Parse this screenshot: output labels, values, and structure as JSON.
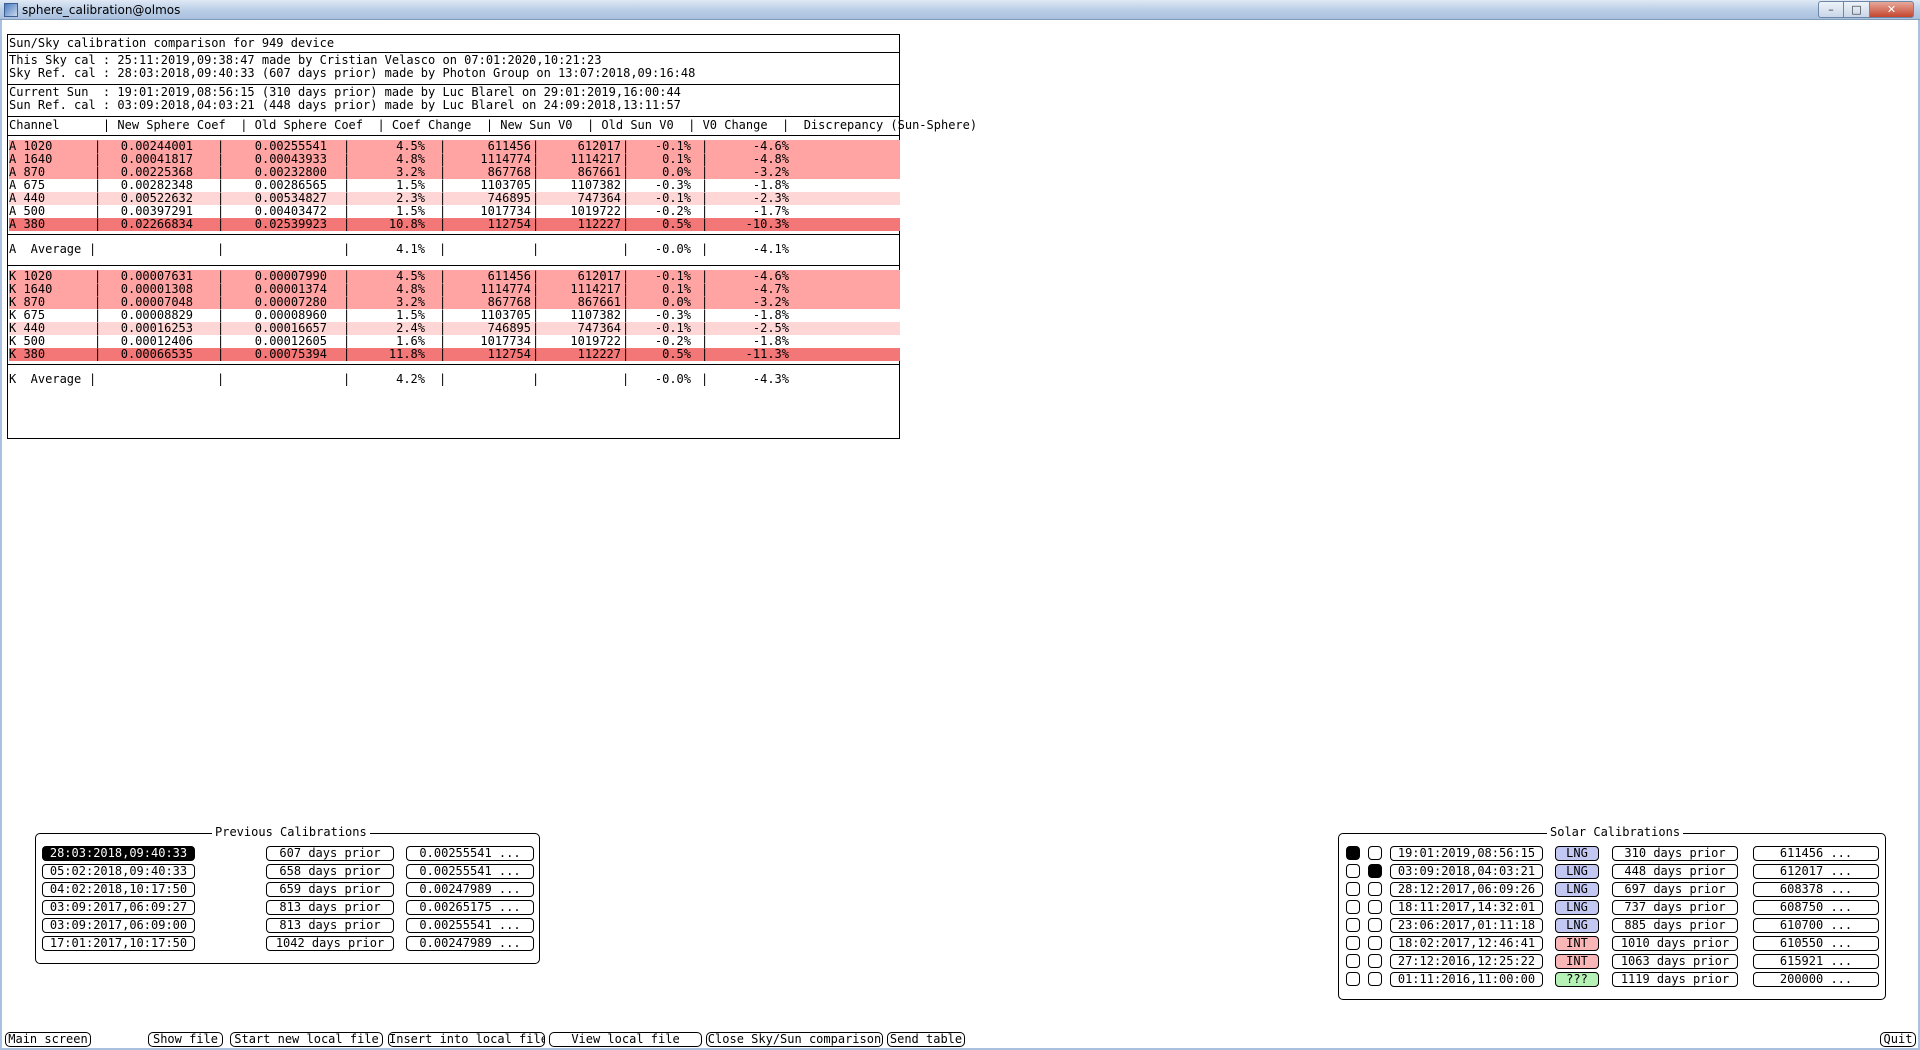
{
  "window": {
    "title": "sphere_calibration@olmos"
  },
  "report": {
    "title": "Sun/Sky calibration comparison for 949 device",
    "sky_cal": "This Sky cal : 25:11:2019,09:38:47 made by Cristian Velasco on 07:01:2020,10:21:23",
    "sky_ref": "Sky Ref. cal : 28:03:2018,09:40:33 (607 days prior) made by Photon Group on 13:07:2018,09:16:48",
    "current_sun": "Current Sun  : 19:01:2019,08:56:15 (310 days prior) made by Luc Blarel on 29:01:2019,16:00:44",
    "sun_ref": "Sun Ref. cal : 03:09:2018,04:03:21 (448 days prior) made by Luc Blarel on 24:09:2018,13:11:57",
    "header": "Channel      | New Sphere Coef  | Old Sphere Coef  | Coef Change  | New Sun V0  | Old Sun V0  | V0 Change  |  Discrepancy (Sun-Sphere)",
    "highlight_colors": {
      "strong": "#f47777",
      "medium": "#ffa3a3",
      "light": "#ffd6d6",
      "none": "#ffffff"
    },
    "a_rows": [
      {
        "ch": "A 1020",
        "new": "0.00244001",
        "old": "0.00255541",
        "coef": "4.5%",
        "nsun": "611456",
        "osun": "612017",
        "v0": "-0.1%",
        "disc": "-4.6%",
        "hl": "medium"
      },
      {
        "ch": "A 1640",
        "new": "0.00041817",
        "old": "0.00043933",
        "coef": "4.8%",
        "nsun": "1114774",
        "osun": "1114217",
        "v0": "0.1%",
        "disc": "-4.8%",
        "hl": "medium"
      },
      {
        "ch": "A 870",
        "new": "0.00225368",
        "old": "0.00232800",
        "coef": "3.2%",
        "nsun": "867768",
        "osun": "867661",
        "v0": "0.0%",
        "disc": "-3.2%",
        "hl": "medium"
      },
      {
        "ch": "A 675",
        "new": "0.00282348",
        "old": "0.00286565",
        "coef": "1.5%",
        "nsun": "1103705",
        "osun": "1107382",
        "v0": "-0.3%",
        "disc": "-1.8%",
        "hl": "none"
      },
      {
        "ch": "A 440",
        "new": "0.00522632",
        "old": "0.00534827",
        "coef": "2.3%",
        "nsun": "746895",
        "osun": "747364",
        "v0": "-0.1%",
        "disc": "-2.3%",
        "hl": "light"
      },
      {
        "ch": "A 500",
        "new": "0.00397291",
        "old": "0.00403472",
        "coef": "1.5%",
        "nsun": "1017734",
        "osun": "1019722",
        "v0": "-0.2%",
        "disc": "-1.7%",
        "hl": "none"
      },
      {
        "ch": "A 380",
        "new": "0.02266834",
        "old": "0.02539923",
        "coef": "10.8%",
        "nsun": "112754",
        "osun": "112227",
        "v0": "0.5%",
        "disc": "-10.3%",
        "hl": "strong"
      }
    ],
    "a_avg": {
      "ch": "A  Average",
      "coef": "4.1%",
      "v0": "-0.0%",
      "disc": "-4.1%"
    },
    "k_rows": [
      {
        "ch": "K 1020",
        "new": "0.00007631",
        "old": "0.00007990",
        "coef": "4.5%",
        "nsun": "611456",
        "osun": "612017",
        "v0": "-0.1%",
        "disc": "-4.6%",
        "hl": "medium"
      },
      {
        "ch": "K 1640",
        "new": "0.00001308",
        "old": "0.00001374",
        "coef": "4.8%",
        "nsun": "1114774",
        "osun": "1114217",
        "v0": "0.1%",
        "disc": "-4.7%",
        "hl": "medium"
      },
      {
        "ch": "K 870",
        "new": "0.00007048",
        "old": "0.00007280",
        "coef": "3.2%",
        "nsun": "867768",
        "osun": "867661",
        "v0": "0.0%",
        "disc": "-3.2%",
        "hl": "medium"
      },
      {
        "ch": "K 675",
        "new": "0.00008829",
        "old": "0.00008960",
        "coef": "1.5%",
        "nsun": "1103705",
        "osun": "1107382",
        "v0": "-0.3%",
        "disc": "-1.8%",
        "hl": "none"
      },
      {
        "ch": "K 440",
        "new": "0.00016253",
        "old": "0.00016657",
        "coef": "2.4%",
        "nsun": "746895",
        "osun": "747364",
        "v0": "-0.1%",
        "disc": "-2.5%",
        "hl": "light"
      },
      {
        "ch": "K 500",
        "new": "0.00012406",
        "old": "0.00012605",
        "coef": "1.6%",
        "nsun": "1017734",
        "osun": "1019722",
        "v0": "-0.2%",
        "disc": "-1.8%",
        "hl": "none"
      },
      {
        "ch": "K 380",
        "new": "0.00066535",
        "old": "0.00075394",
        "coef": "11.8%",
        "nsun": "112754",
        "osun": "112227",
        "v0": "0.5%",
        "disc": "-11.3%",
        "hl": "strong"
      }
    ],
    "k_avg": {
      "ch": "K  Average",
      "coef": "4.2%",
      "v0": "-0.0%",
      "disc": "-4.3%"
    }
  },
  "previous_calibrations": {
    "caption": "Previous Calibrations",
    "rows": [
      {
        "date": "28:03:2018,09:40:33",
        "prior": "607 days prior",
        "value": "0.00255541 ...",
        "selected": true
      },
      {
        "date": "05:02:2018,09:40:33",
        "prior": "658 days prior",
        "value": "0.00255541 ...",
        "selected": false
      },
      {
        "date": "04:02:2018,10:17:50",
        "prior": "659 days prior",
        "value": "0.00247989 ...",
        "selected": false
      },
      {
        "date": "03:09:2017,06:09:27",
        "prior": "813 days prior",
        "value": "0.00265175 ...",
        "selected": false
      },
      {
        "date": "03:09:2017,06:09:00",
        "prior": "813 days prior",
        "value": "0.00255541 ...",
        "selected": false
      },
      {
        "date": "17:01:2017,10:17:50",
        "prior": "1042 days prior",
        "value": "0.00247989 ...",
        "selected": false
      }
    ]
  },
  "solar_calibrations": {
    "caption": "Solar Calibrations",
    "tag_colors": {
      "LNG": "#c3c8f2",
      "INT": "#f8b6b6",
      "???": "#b6f2b6"
    },
    "rows": [
      {
        "c1": true,
        "c2": false,
        "date": "19:01:2019,08:56:15",
        "tag": "LNG",
        "prior": "310 days prior",
        "value": "611456 ..."
      },
      {
        "c1": false,
        "c2": true,
        "date": "03:09:2018,04:03:21",
        "tag": "LNG",
        "prior": "448 days prior",
        "value": "612017 ..."
      },
      {
        "c1": false,
        "c2": false,
        "date": "28:12:2017,06:09:26",
        "tag": "LNG",
        "prior": "697 days prior",
        "value": "608378 ..."
      },
      {
        "c1": false,
        "c2": false,
        "date": "18:11:2017,14:32:01",
        "tag": "LNG",
        "prior": "737 days prior",
        "value": "608750 ..."
      },
      {
        "c1": false,
        "c2": false,
        "date": "23:06:2017,01:11:18",
        "tag": "LNG",
        "prior": "885 days prior",
        "value": "610700 ..."
      },
      {
        "c1": false,
        "c2": false,
        "date": "18:02:2017,12:46:41",
        "tag": "INT",
        "prior": "1010 days prior",
        "value": "610550 ..."
      },
      {
        "c1": false,
        "c2": false,
        "date": "27:12:2016,12:25:22",
        "tag": "INT",
        "prior": "1063 days prior",
        "value": "615921 ..."
      },
      {
        "c1": false,
        "c2": false,
        "date": "01:11:2016,11:00:00",
        "tag": "???",
        "prior": "1119 days prior",
        "value": "200000 ..."
      }
    ]
  },
  "toolbar": {
    "main_screen": "Main screen",
    "show_file": "Show file",
    "start_new_local_file": "Start new local file",
    "insert_into_local_file": "Insert into local file",
    "view_local_file": "View local file",
    "close_comparison": "Close Sky/Sun comparison",
    "send_table": "Send table",
    "quit": "Quit"
  }
}
